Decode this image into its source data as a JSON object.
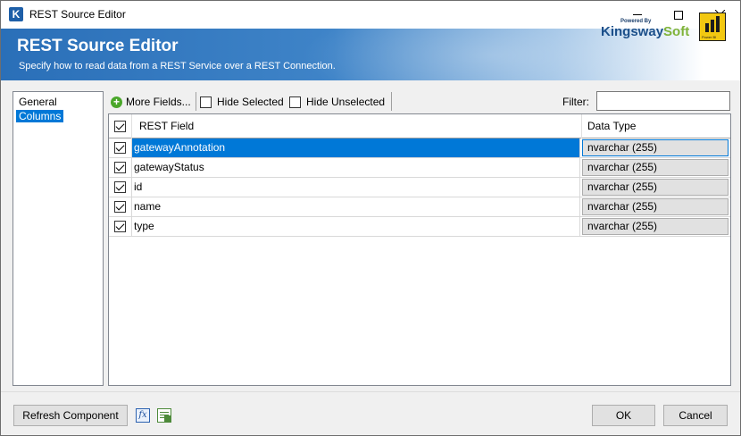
{
  "window": {
    "title": "REST Source Editor",
    "icon_letter": "K"
  },
  "banner": {
    "title": "REST Source Editor",
    "subtitle": "Specify how to read data from a REST Service over a REST Connection.",
    "brand_powered": "Powered By",
    "brand_name_k": "K",
    "brand_name_ingsway": "ingsway",
    "brand_name_soft": "Soft",
    "pbi_label": "Power BI"
  },
  "nav": {
    "items": [
      {
        "label": "General",
        "selected": false
      },
      {
        "label": "Columns",
        "selected": true
      }
    ]
  },
  "toolbar": {
    "more_fields": "More Fields...",
    "hide_selected": "Hide Selected",
    "hide_unselected": "Hide Unselected",
    "filter_label": "Filter:",
    "filter_value": ""
  },
  "grid": {
    "columns": [
      "REST Field",
      "Data Type"
    ],
    "rows": [
      {
        "field": "gatewayAnnotation",
        "type": "nvarchar (255)",
        "checked": true,
        "selected": true
      },
      {
        "field": "gatewayStatus",
        "type": "nvarchar (255)",
        "checked": true,
        "selected": false
      },
      {
        "field": "id",
        "type": "nvarchar (255)",
        "checked": true,
        "selected": false
      },
      {
        "field": "name",
        "type": "nvarchar (255)",
        "checked": true,
        "selected": false
      },
      {
        "field": "type",
        "type": "nvarchar (255)",
        "checked": true,
        "selected": false
      }
    ]
  },
  "footer": {
    "refresh": "Refresh Component",
    "fx_icon_glyph": "fx",
    "ok": "OK",
    "cancel": "Cancel"
  },
  "colors": {
    "accent": "#0078d7",
    "banner": "#2a6fb8",
    "brand_green": "#7fb339"
  }
}
